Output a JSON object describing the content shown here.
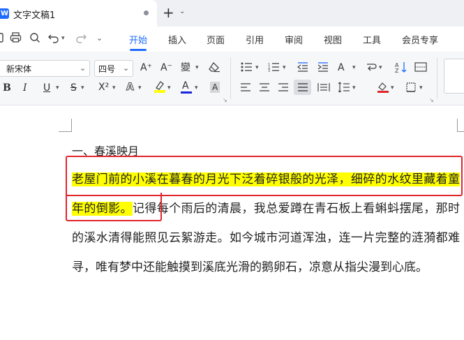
{
  "window": {
    "app_logo": "W",
    "doc_title": "文字文稿1",
    "new_tab": "+",
    "new_tab_arrow": "⌄"
  },
  "menu": {
    "items": [
      "开始",
      "插入",
      "页面",
      "引用",
      "审阅",
      "视图",
      "工具",
      "会员专享"
    ],
    "active": "开始",
    "accent_color": "#1f6bff"
  },
  "quick_access": {
    "icons": [
      "save-icon",
      "print-icon",
      "undo-icon",
      "redo-icon",
      "more-icon"
    ]
  },
  "ribbon": {
    "font_name": "新宋体",
    "font_size": "四号",
    "row1_icons": [
      "increase-font-icon",
      "decrease-font-icon",
      "phonetic-icon",
      "clear-format-icon",
      "bullets-icon",
      "numbering-icon",
      "decrease-indent-icon",
      "increase-indent-icon",
      "text-direction-icon",
      "sort-icon",
      "table-icon"
    ],
    "row2_icons": [
      "bold-icon",
      "italic-icon",
      "underline-icon",
      "strikethrough-icon",
      "superscript-icon",
      "text-effect-icon",
      "highlight-icon",
      "font-color-icon",
      "char-shading-icon",
      "align-left-icon",
      "align-center-icon",
      "align-right-icon",
      "justify-icon",
      "distributed-icon",
      "line-spacing-icon",
      "shading-icon",
      "border-icon"
    ],
    "labels": {
      "bold": "B",
      "italic": "I",
      "underline": "U",
      "strike": "S",
      "superscript": "X²",
      "font_effect": "A",
      "font_color": "A",
      "char_shading": "A",
      "grow": "A⁺",
      "shrink": "A⁻",
      "phonetic": "變"
    }
  },
  "document": {
    "heading": "一、春溪映月",
    "highlighted_text": "老屋门前的小溪在暮春的月光下泛着碎银般的光泽，细碎的水纹里藏着童年的倒影。",
    "body_text": "记得每个雨后的清晨，我总爱蹲在青石板上看蝌蚪摆尾，那时的溪水清得能照见云絮游走。如今城市河道浑浊，连一片完整的涟漪都难寻，唯有梦中还能触摸到溪底光滑的鹅卵石，凉意从指尖漫到心底。",
    "highlight_color": "#ffff00",
    "annotation_color": "#e0252b"
  }
}
